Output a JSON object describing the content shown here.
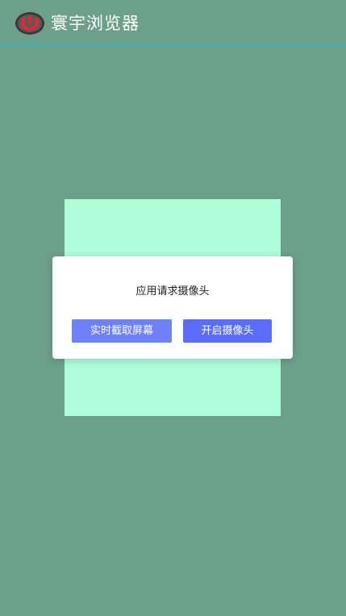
{
  "app": {
    "title": "寰宇浏览器",
    "logo_icon": "power-logo-icon",
    "accent_color": "#2bb6d8",
    "background_color": "#6da08a"
  },
  "preview": {
    "color": "#adfdd9"
  },
  "dialog": {
    "message": "应用请求摄像头",
    "capture_screen_label": "实时截取屏幕",
    "open_camera_label": "开启摄像头",
    "capture_screen_color": "#6e80fa",
    "open_camera_color": "#5a6cfb"
  }
}
